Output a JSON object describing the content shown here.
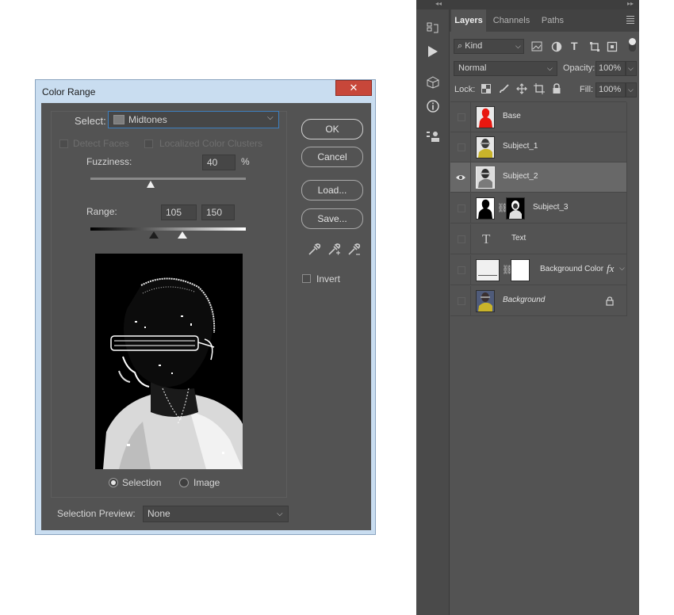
{
  "dialog": {
    "title": "Color Range",
    "close_glyph": "✕",
    "select_label": "Select:",
    "select_value": "Midtones",
    "detect_faces": "Detect Faces",
    "localized_clusters": "Localized Color Clusters",
    "fuzziness_label": "Fuzziness:",
    "fuzziness_value": "40",
    "fuzziness_unit": "%",
    "fuzziness_level": 0.39,
    "range_label": "Range:",
    "range_low": "105",
    "range_high": "150",
    "range_low_level": 0.41,
    "range_high_level": 0.59,
    "buttons": {
      "ok": "OK",
      "cancel": "Cancel",
      "load": "Load...",
      "save": "Save..."
    },
    "invert_label": "Invert",
    "view_selection": "Selection",
    "view_image": "Image",
    "preview_label": "Selection Preview:",
    "preview_value": "None"
  },
  "layers_panel": {
    "collapse_glyph": "◂◂",
    "expand_glyph": "▸▸",
    "tabs": [
      "Layers",
      "Channels",
      "Paths"
    ],
    "active_tab": "Layers",
    "filter_kind": "Kind",
    "blend_mode": "Normal",
    "opacity_label": "Opacity:",
    "opacity_value": "100%",
    "lock_label": "Lock:",
    "fill_label": "Fill:",
    "fill_value": "100%",
    "layers": [
      {
        "name": "Base",
        "visible": false
      },
      {
        "name": "Subject_1",
        "visible": false
      },
      {
        "name": "Subject_2",
        "visible": true,
        "selected": true
      },
      {
        "name": "Subject_3",
        "visible": false
      },
      {
        "name": "Text",
        "visible": false
      },
      {
        "name": "Background Color",
        "visible": false,
        "fx": "fx"
      },
      {
        "name": "Background",
        "visible": false,
        "locked": true
      }
    ],
    "text_glyph": "T",
    "colors": {
      "selected_row": "#686868",
      "base_thumb": "#e8170f",
      "subject_shirt": "#c9b42a"
    }
  }
}
